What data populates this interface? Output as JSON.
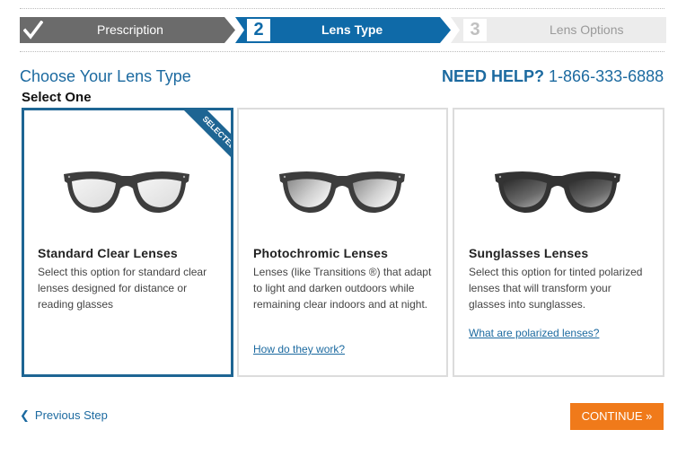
{
  "steps": [
    {
      "label": "Prescription",
      "state": "complete",
      "icon": "checkmark-icon"
    },
    {
      "number": "2",
      "label": "Lens Type",
      "state": "active"
    },
    {
      "number": "3",
      "label": "Lens Options",
      "state": "upcoming"
    }
  ],
  "colors": {
    "active": "#0f6aa8",
    "complete": "#6b6b6b",
    "upcoming": "#ececec",
    "accent": "#1c6aa0",
    "button": "#f07a1a"
  },
  "heading": "Choose Your Lens Type",
  "help": {
    "label": "NEED HELP?",
    "phone": "1-866-333-6888"
  },
  "select_one": "Select One",
  "lenses": [
    {
      "title": "Standard Clear Lenses",
      "description": "Select this option for standard clear lenses designed for distance or reading glasses",
      "selected": true,
      "ribbon": "SELECTED"
    },
    {
      "title": "Photochromic Lenses",
      "description": "Lenses (like Transitions ®) that adapt to light and darken outdoors while remaining clear indoors and at night.",
      "link": "How do they work?",
      "selected": false
    },
    {
      "title": "Sunglasses Lenses",
      "description": "Select this option for tinted polarized lenses that will transform your glasses into sunglasses.",
      "link": "What are polarized lenses?",
      "selected": false
    }
  ],
  "nav": {
    "previous": "Previous Step",
    "continue": "CONTINUE »"
  }
}
